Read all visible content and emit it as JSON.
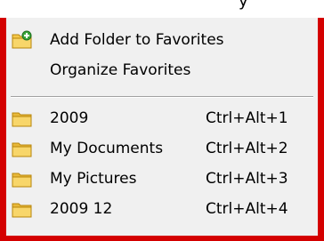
{
  "header": {
    "partial_text": "y"
  },
  "menu": {
    "add_folder": {
      "label": "Add Folder to Favorites",
      "icon": "add-folder-icon"
    },
    "organize": {
      "label": "Organize Favorites"
    },
    "favorites": [
      {
        "label": "2009",
        "shortcut": "Ctrl+Alt+1",
        "icon": "folder-icon"
      },
      {
        "label": "My Documents",
        "shortcut": "Ctrl+Alt+2",
        "icon": "folder-icon"
      },
      {
        "label": "My Pictures",
        "shortcut": "Ctrl+Alt+3",
        "icon": "folder-icon"
      },
      {
        "label": "2009 12",
        "shortcut": "Ctrl+Alt+4",
        "icon": "folder-icon"
      }
    ]
  },
  "colors": {
    "frame": "#d40000",
    "menu_bg": "#f0f0f0",
    "folder_yellow": "#f5c84a",
    "folder_dark": "#c99a1f",
    "add_green": "#3aa63a"
  }
}
